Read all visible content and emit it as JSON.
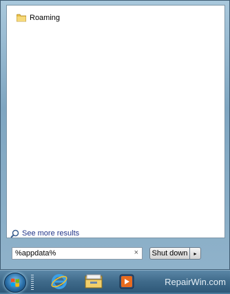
{
  "results": {
    "items": [
      {
        "label": "Roaming",
        "icon": "folder-icon"
      }
    ],
    "see_more": "See more results"
  },
  "search": {
    "value": "%appdata%",
    "clear_glyph": "×"
  },
  "shutdown": {
    "label": "Shut down",
    "arrow_glyph": "▸"
  },
  "taskbar": {
    "pinned": [
      "internet-explorer-icon",
      "windows-explorer-icon",
      "media-player-icon"
    ],
    "watermark": "RepairWin.com"
  },
  "colors": {
    "link": "#1e3287",
    "taskbar": "#3f6a8a"
  }
}
